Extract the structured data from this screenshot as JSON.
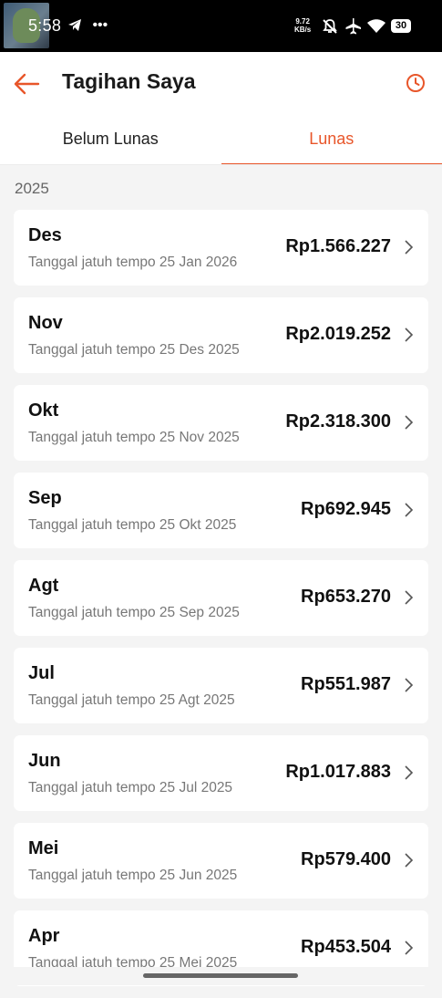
{
  "status_bar": {
    "time": "5:58",
    "net_speed_value": "9.72",
    "net_speed_unit": "KB/s",
    "battery": "30",
    "icons": [
      "telegram-icon",
      "more-icon",
      "mute-icon",
      "airplane-icon",
      "wifi-icon",
      "battery-icon"
    ]
  },
  "header": {
    "title": "Tagihan Saya",
    "back_icon": "arrow-left-icon",
    "history_icon": "clock-icon"
  },
  "tabs": [
    {
      "label": "Belum Lunas",
      "active": false
    },
    {
      "label": "Lunas",
      "active": true
    }
  ],
  "year": "2025",
  "bills": [
    {
      "month": "Des",
      "due": "Tanggal jatuh tempo 25 Jan 2026",
      "amount": "Rp1.566.227"
    },
    {
      "month": "Nov",
      "due": "Tanggal jatuh tempo 25 Des 2025",
      "amount": "Rp2.019.252"
    },
    {
      "month": "Okt",
      "due": "Tanggal jatuh tempo 25 Nov 2025",
      "amount": "Rp2.318.300"
    },
    {
      "month": "Sep",
      "due": "Tanggal jatuh tempo 25 Okt 2025",
      "amount": "Rp692.945"
    },
    {
      "month": "Agt",
      "due": "Tanggal jatuh tempo 25 Sep 2025",
      "amount": "Rp653.270"
    },
    {
      "month": "Jul",
      "due": "Tanggal jatuh tempo 25 Agt 2025",
      "amount": "Rp551.987"
    },
    {
      "month": "Jun",
      "due": "Tanggal jatuh tempo 25 Jul 2025",
      "amount": "Rp1.017.883"
    },
    {
      "month": "Mei",
      "due": "Tanggal jatuh tempo 25 Jun 2025",
      "amount": "Rp579.400"
    },
    {
      "month": "Apr",
      "due": "Tanggal jatuh tempo 25 Mei 2025",
      "amount": "Rp453.504"
    }
  ],
  "colors": {
    "accent": "#e8562a",
    "background": "#f4f4f4",
    "card": "#ffffff"
  }
}
